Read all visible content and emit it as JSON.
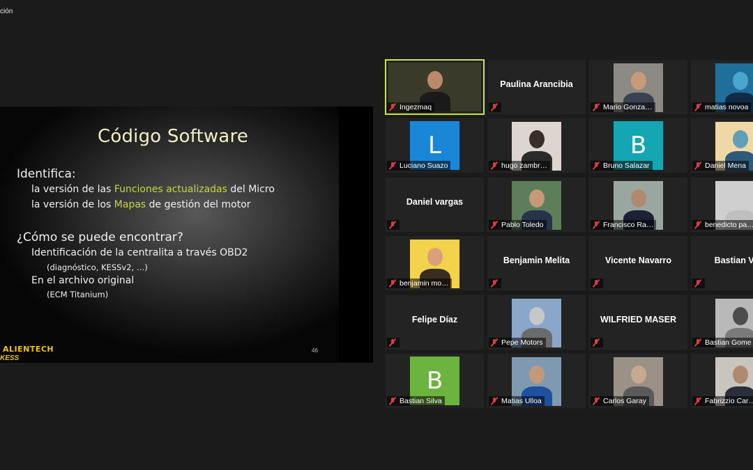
{
  "window": {
    "title_fragment": "ción"
  },
  "slide": {
    "title": "Código Software",
    "identifica": "Identifica:",
    "line1_prefix": "la versión de las ",
    "line1_highlight": "Funciones actualizadas",
    "line1_suffix": " del Micro",
    "line2_prefix": "la versión de los ",
    "line2_highlight": "Mapas",
    "line2_suffix": " de gestión del motor",
    "question": "¿Cómo se puede encontrar?",
    "sub1": "Identificación de la centralita a través OBD2",
    "sub1_detail": "(diagnóstico, KESSv2, …)",
    "sub2": "En el archivo original",
    "sub2_detail": "(ECM Titanium)",
    "logo": "ALIENTECH",
    "logo_sub": "KESS",
    "page_number": "46"
  },
  "participants": [
    {
      "name": "Ingezmaq",
      "kind": "video",
      "active": true
    },
    {
      "name": "Paulina Arancibia",
      "kind": "name"
    },
    {
      "name": "Mario Gonza…",
      "kind": "photo"
    },
    {
      "name": "matias novoa",
      "kind": "photo"
    },
    {
      "name": "Luciano Suazo",
      "kind": "avatar",
      "letter": "L",
      "color": "#1a86d6"
    },
    {
      "name": "hugo zambr…",
      "kind": "photo"
    },
    {
      "name": "Bruno Salazar",
      "kind": "avatar",
      "letter": "B",
      "color": "#15a6b3"
    },
    {
      "name": "Daniel Mena",
      "kind": "photo"
    },
    {
      "name": "Daniel vargas",
      "kind": "name"
    },
    {
      "name": "Pablo Toledo",
      "kind": "photo"
    },
    {
      "name": "Francisco Ra…",
      "kind": "photo"
    },
    {
      "name": "benedicto pa…",
      "kind": "photo"
    },
    {
      "name": "benjamin mo…",
      "kind": "photo"
    },
    {
      "name": "Benjamin Melita",
      "kind": "name"
    },
    {
      "name": "Vicente Navarro",
      "kind": "name"
    },
    {
      "name": "Bastian Vale",
      "kind": "name"
    },
    {
      "name": "Felipe Díaz",
      "kind": "name"
    },
    {
      "name": "Pepe Motors",
      "kind": "photo"
    },
    {
      "name": "WILFRIED MASER",
      "kind": "name"
    },
    {
      "name": "Bastian Gome",
      "kind": "photo"
    },
    {
      "name": "Bastian Silva",
      "kind": "avatar",
      "letter": "B",
      "color": "#6db33f"
    },
    {
      "name": "Matias Ulloa",
      "kind": "photo"
    },
    {
      "name": "Carlos Garay",
      "kind": "photo"
    },
    {
      "name": "Fabrizzio Car…",
      "kind": "photo"
    }
  ]
}
